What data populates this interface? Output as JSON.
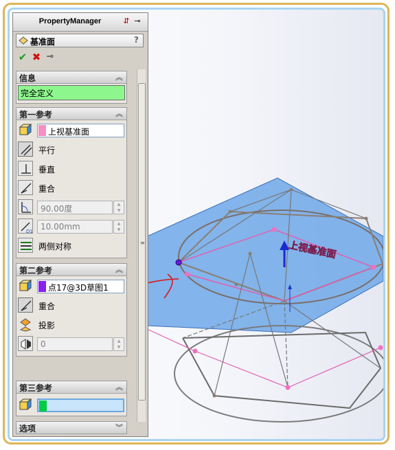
{
  "panel": {
    "header_title": "PropertyManager",
    "feature_title": "基准面",
    "help_label": "?"
  },
  "groups": {
    "info": {
      "title": "信息",
      "status": "完全定义"
    },
    "first_ref": {
      "title": "第一参考",
      "selection": "上视基准面",
      "selection_color": "#f58fc4",
      "options": [
        "平行",
        "垂直",
        "重合"
      ],
      "angle_value": "90.00度",
      "distance_value": "10.00mm",
      "mirror_label": "两侧对称"
    },
    "second_ref": {
      "title": "第二参考",
      "selection": "点17@3D草图1",
      "selection_color": "#8a1ff0",
      "options": [
        "重合",
        "投影"
      ],
      "count_value": "0"
    },
    "third_ref": {
      "title": "第三参考",
      "selection": "",
      "selection_color": "#00cc44"
    },
    "options_group": {
      "title": "选项"
    }
  },
  "viewport": {
    "plane_label": "上视基准面",
    "plane_color": "#6fa8e8"
  },
  "icons": [
    "plane-icon",
    "ok-icon",
    "cancel-icon",
    "pushpin-icon",
    "collapse-chevron-icon",
    "expand-chevron-icon",
    "parallel-icon",
    "perpendicular-icon",
    "coincident-icon",
    "angle-icon",
    "distance-icon",
    "mirror-icon",
    "projection-icon",
    "flip-icon",
    "reference-cube-icon"
  ]
}
